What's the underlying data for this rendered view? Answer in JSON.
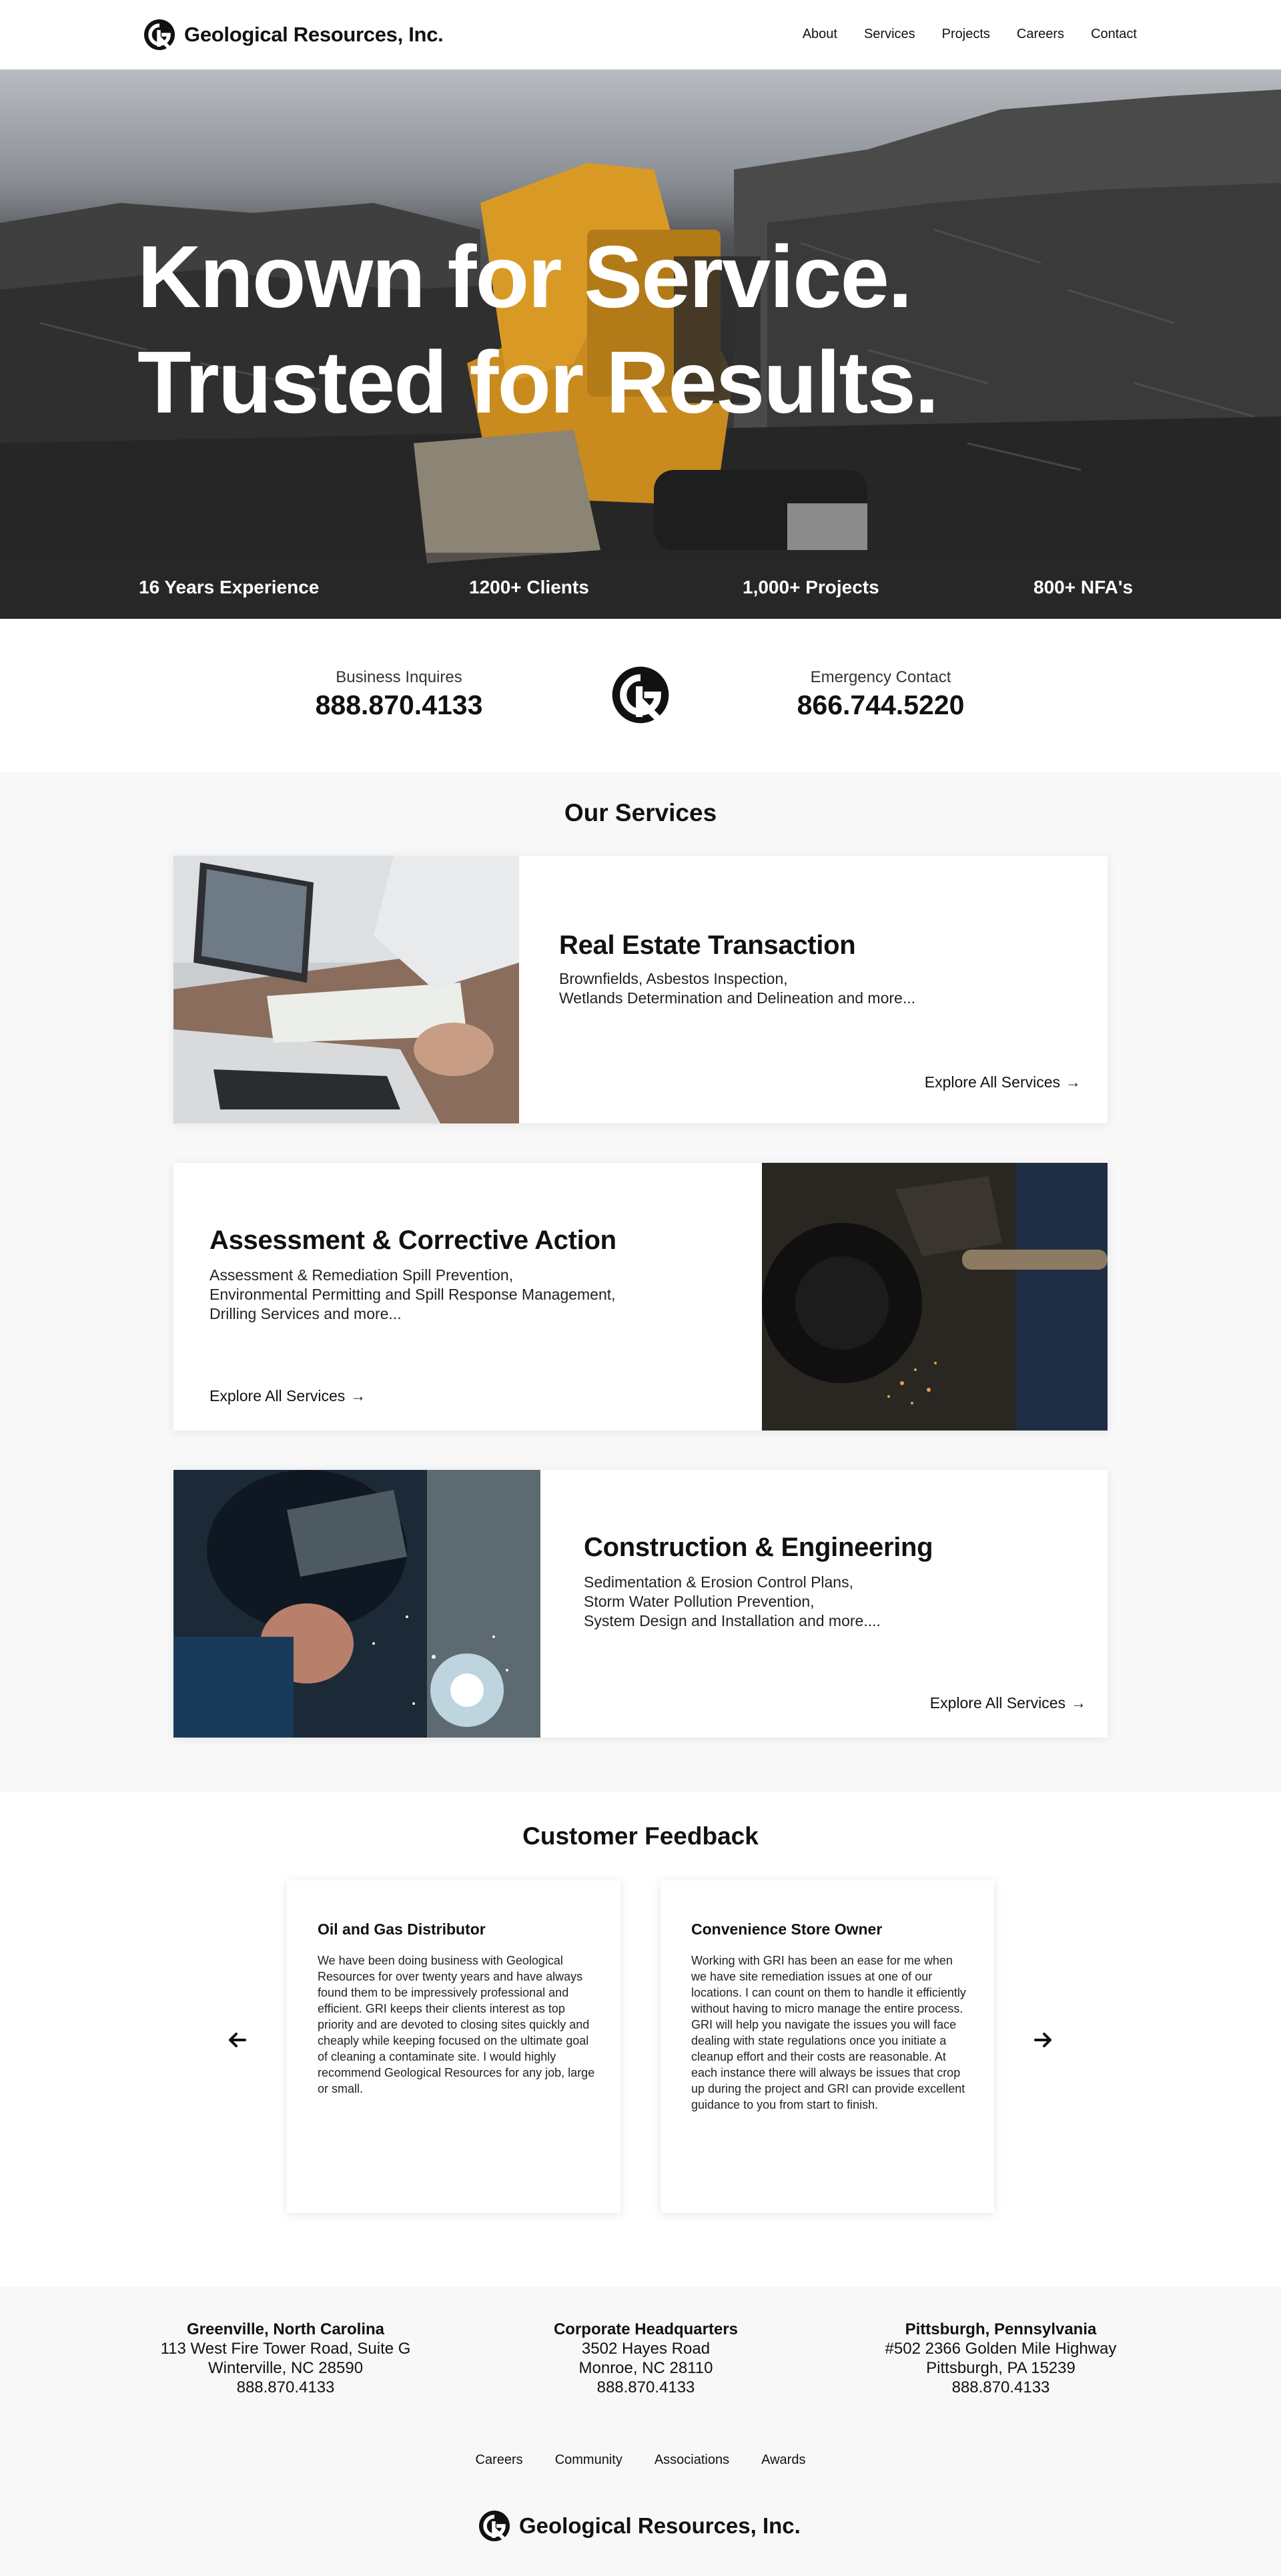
{
  "header": {
    "brand_name": "Geological Resources, Inc.",
    "nav": [
      "About",
      "Services",
      "Projects",
      "Careers",
      "Contact"
    ]
  },
  "hero": {
    "line1": "Known for Service.",
    "line2": "Trusted for Results.",
    "stats": [
      "16 Years Experience",
      "1200+ Clients",
      "1,000+ Projects",
      "800+ NFA's"
    ]
  },
  "contact": {
    "business_label": "Business Inquires",
    "business_phone": "888.870.4133",
    "emergency_label": "Emergency Contact",
    "emergency_phone": "866.744.5220"
  },
  "services": {
    "title": "Our Services",
    "cards": [
      {
        "title": "Real Estate Transaction",
        "desc": [
          "Brownfields, Asbestos Inspection,",
          "Wetlands Determination and Delineation and more..."
        ],
        "cta": "Explore All Services"
      },
      {
        "title": "Assessment & Corrective Action",
        "desc": [
          "Assessment & Remediation Spill Prevention,",
          "Environmental Permitting and Spill Response Management,",
          "Drilling Services and more..."
        ],
        "cta": "Explore All Services"
      },
      {
        "title": "Construction & Engineering",
        "desc": [
          "Sedimentation & Erosion Control Plans,",
          "Storm Water Pollution Prevention,",
          "System Design and Installation and more...."
        ],
        "cta": "Explore All Services"
      }
    ]
  },
  "feedback": {
    "title": "Customer Feedback",
    "items": [
      {
        "title": "Oil and Gas Distributor",
        "text": "We have been doing business with Geological Resources for over twenty years and have always found them to be impressively professional and efficient. GRI keeps their clients interest as top priority and are devoted to closing sites quickly and cheaply while keeping focused on the ultimate goal of cleaning a contaminate site. I would highly recommend Geological Resources for any job, large or small."
      },
      {
        "title": "Convenience Store Owner",
        "text": "Working with GRI has been an ease for me when we have site remediation issues at one of our locations. I can count on them to handle it efficiently without having to micro manage the entire process. GRI will help you navigate the issues you will face dealing with state regulations once you initiate a cleanup effort and their costs are reasonable. At each instance there will always be issues that crop up during the project and GRI can provide excellent guidance to you from start to finish."
      }
    ]
  },
  "footer": {
    "offices": [
      {
        "title": "Greenville, North Carolina",
        "line1": "113 West Fire Tower Road, Suite G",
        "line2": "Winterville, NC 28590",
        "phone": "888.870.4133"
      },
      {
        "title": "Corporate Headquarters",
        "line1": "3502 Hayes Road",
        "line2": "Monroe, NC 28110",
        "phone": "888.870.4133"
      },
      {
        "title": "Pittsburgh, Pennsylvania",
        "line1": "#502 2366 Golden Mile Highway",
        "line2": "Pittsburgh, PA 15239",
        "phone": "888.870.4133"
      }
    ],
    "links": [
      "Careers",
      "Community",
      "Associations",
      "Awards"
    ],
    "brand_name": "Geological Resources, Inc."
  }
}
